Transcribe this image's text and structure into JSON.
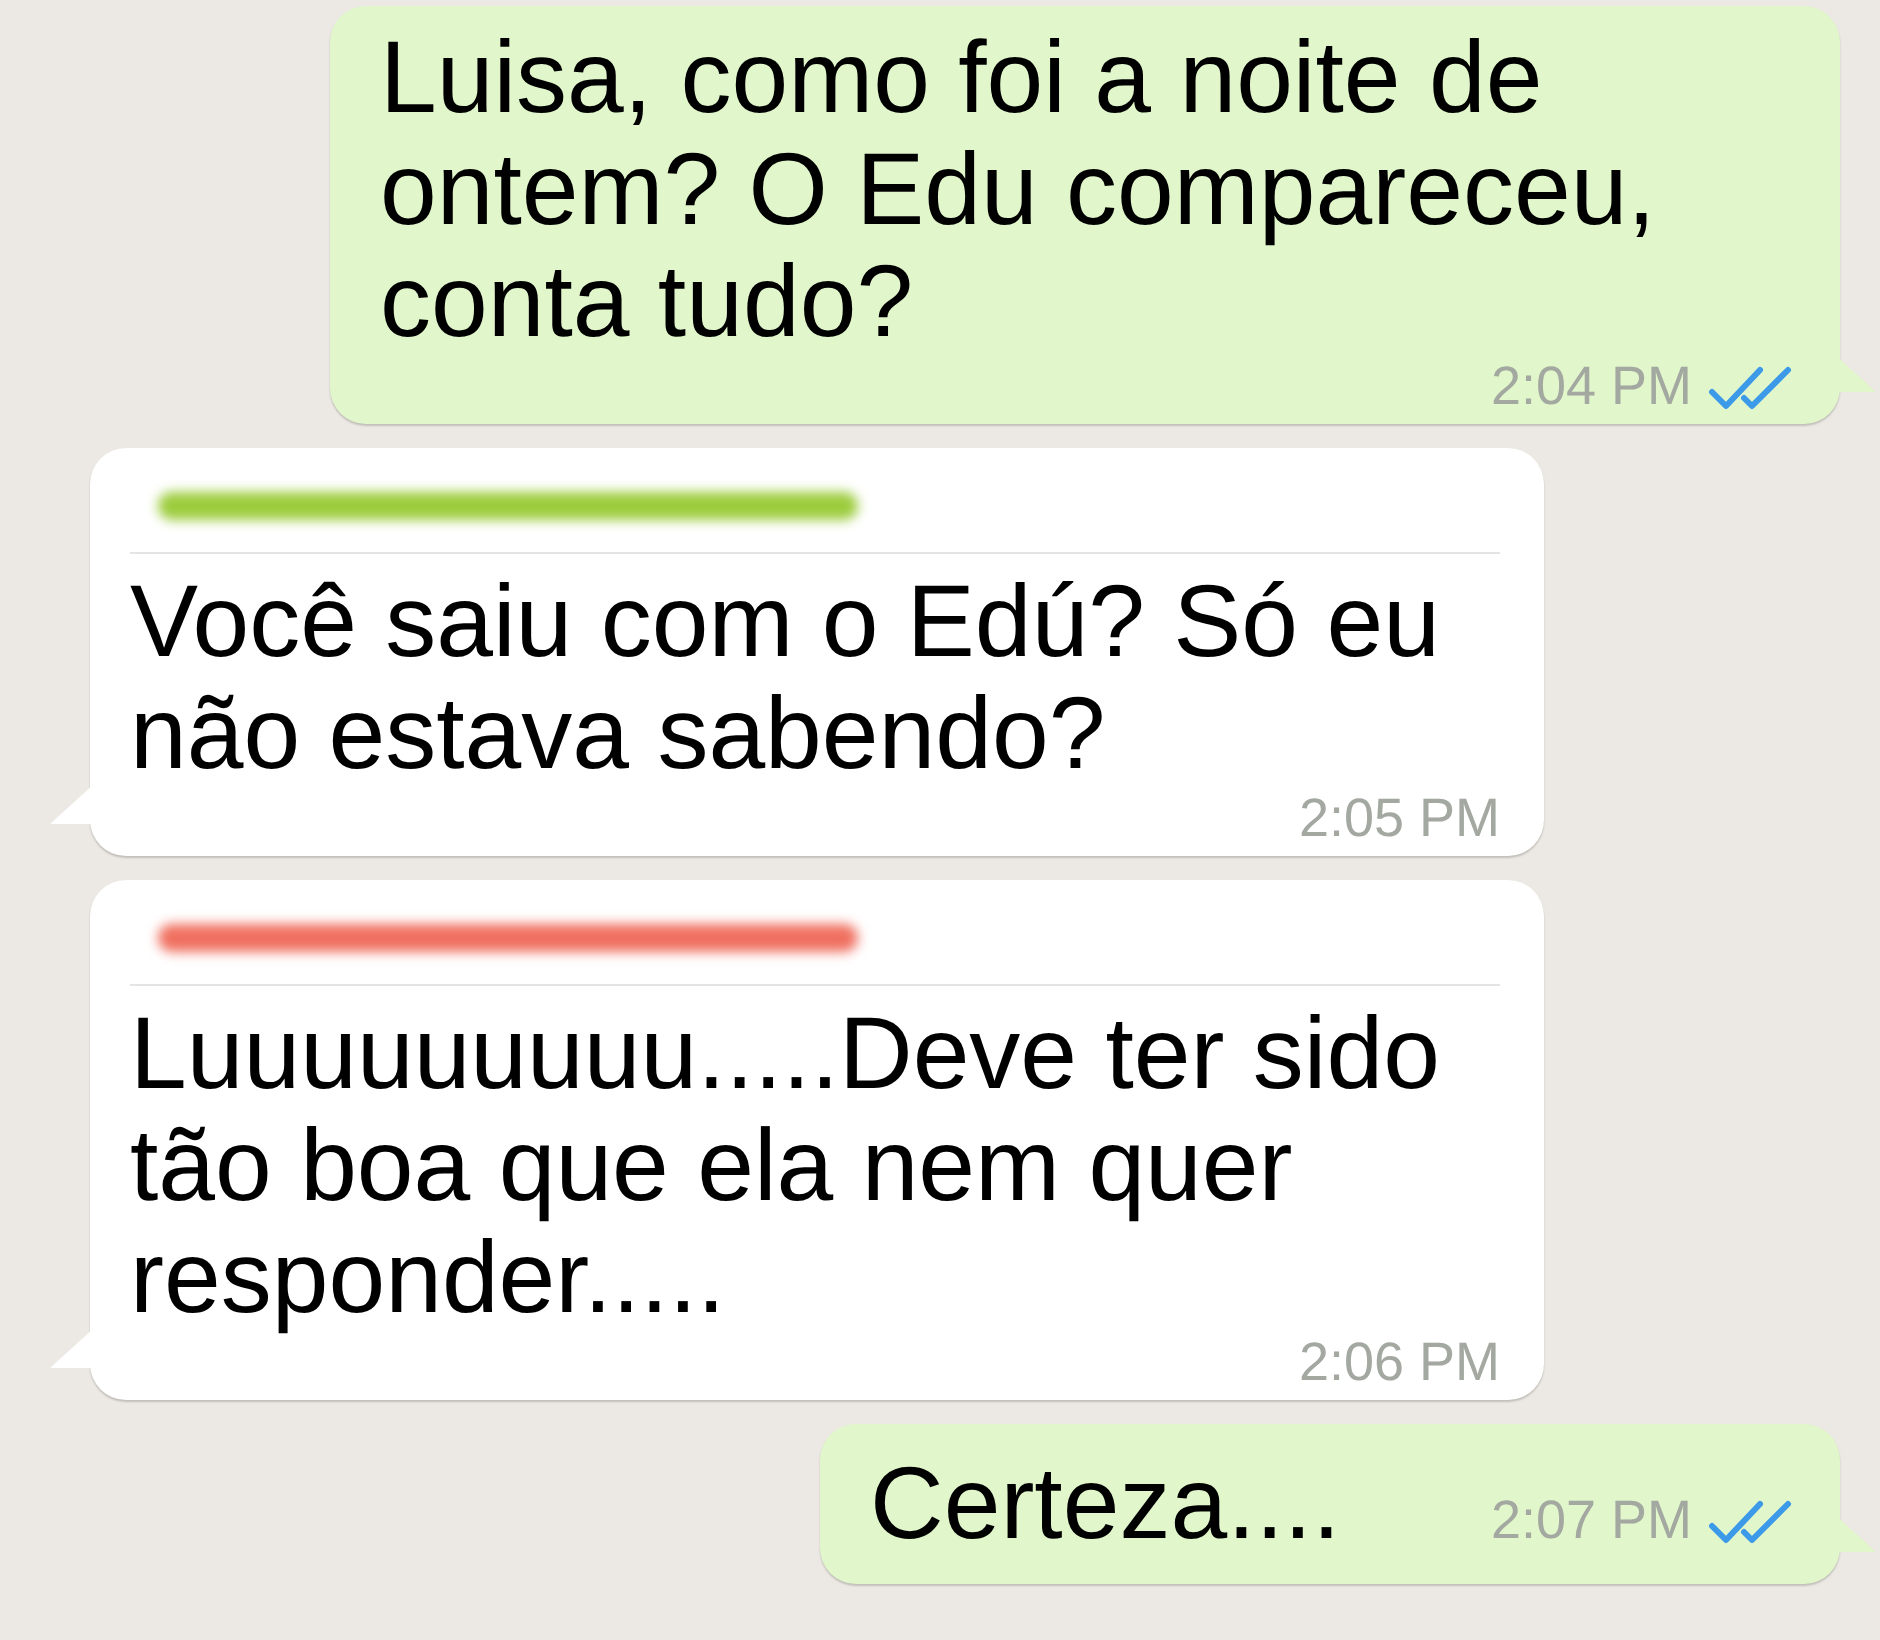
{
  "messages": [
    {
      "kind": "outgoing",
      "text": "Luisa, como foi a noite de ontem? O Edu compareceu, conta tudo?",
      "time": "2:04 PM",
      "read": true
    },
    {
      "kind": "incoming",
      "color": "#9ccc3c",
      "text": "Você saiu com o Edú? Só eu não estava sabendo?",
      "time": "2:05 PM"
    },
    {
      "kind": "incoming",
      "color": "#f07060",
      "text": "Luuuuuuuuu.....Deve ter sido tão boa que ela nem quer responder.....",
      "time": "2:06 PM"
    },
    {
      "kind": "outgoing",
      "text": "Certeza....",
      "time": "2:07 PM",
      "read": true
    }
  ]
}
